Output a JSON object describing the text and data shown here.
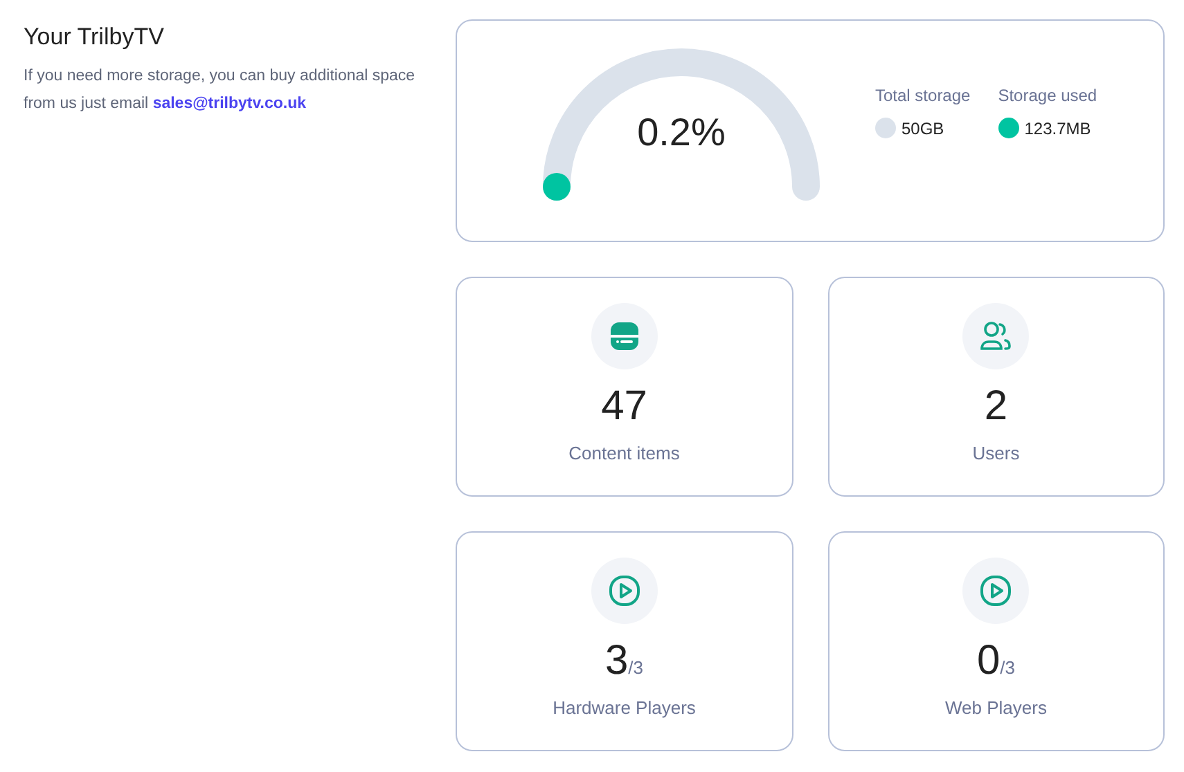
{
  "intro": {
    "title": "Your TrilbyTV",
    "text": "If you need more storage, you can buy additional space from us just email",
    "email": "sales@trilbytv.co.uk"
  },
  "storage": {
    "percent": "0.2%",
    "legend": [
      {
        "label": "Total storage",
        "value": "50GB",
        "color": "#dbe2eb"
      },
      {
        "label": "Storage used",
        "value": "123.7MB",
        "color": "#00c4a1"
      }
    ]
  },
  "stats": [
    {
      "kind": "content",
      "value": "47",
      "label": "Content items"
    },
    {
      "kind": "users",
      "value": "2",
      "label": "Users"
    },
    {
      "kind": "player",
      "value": "3",
      "limit": "/3",
      "label": "Hardware Players"
    },
    {
      "kind": "player",
      "value": "0",
      "limit": "/3",
      "label": "Web Players"
    }
  ]
}
